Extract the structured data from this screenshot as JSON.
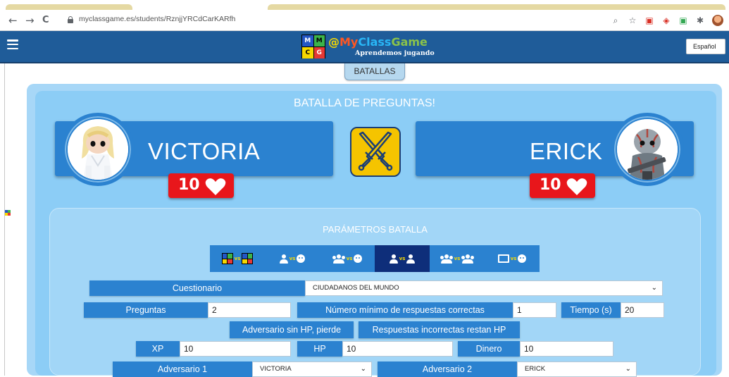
{
  "browser": {
    "url": "myclassgame.es/students/RznjjYRCdCarKARfh",
    "back_icon": "←",
    "forward_icon": "→",
    "reload_icon": "C",
    "zoom_icon": "⌕",
    "star_icon": "☆"
  },
  "header": {
    "logo_letters": [
      "M",
      "M",
      "C",
      "G"
    ],
    "brand_at": "@",
    "brand_my": "My",
    "brand_class": "Class",
    "brand_game": "Game",
    "tagline": "Aprendemos jugando",
    "language": "Español"
  },
  "tabs": {
    "battles": "BATALLAS"
  },
  "battle": {
    "title": "BATALLA DE PREGUNTAS!",
    "player1": {
      "name": "VICTORIA",
      "hp": "10"
    },
    "player2": {
      "name": "ERICK",
      "hp": "10"
    }
  },
  "params": {
    "title": "PARÁMETROS BATALLA",
    "modes": [
      {
        "name": "class-vs-class",
        "vs": "vs"
      },
      {
        "name": "student-vs-face",
        "vs": "vs"
      },
      {
        "name": "team-vs-face",
        "vs": "vs"
      },
      {
        "name": "student-vs-student",
        "vs": "vs",
        "active": true
      },
      {
        "name": "team-vs-team",
        "vs": "vs"
      },
      {
        "name": "board-vs-face",
        "vs": "vs"
      }
    ],
    "questionnaire_label": "Cuestionario",
    "questionnaire_value": "CIUDADANOS DEL MUNDO",
    "questions_label": "Preguntas",
    "questions_value": "2",
    "min_correct_label": "Número mínimo de respuestas correctas",
    "min_correct_value": "1",
    "time_label": "Tiempo (s)",
    "time_value": "20",
    "no_hp_label": "Adversario sin HP, pierde",
    "wrong_answers_label": "Respuestas incorrectas restan HP",
    "xp_label": "XP",
    "xp_value": "10",
    "hp_label": "HP",
    "hp_value": "10",
    "money_label": "Dinero",
    "money_value": "10",
    "adv1_label": "Adversario 1",
    "adv1_value": "VICTORIA",
    "adv2_label": "Adversario 2",
    "adv2_value": "ERICK"
  },
  "colors": {
    "header_blue": "#1f5c99",
    "panel_blue": "#2b82d0",
    "light_blue": "#a7d7f7",
    "hp_red": "#e8161b",
    "swords_yellow": "#f5c400",
    "active_mode": "#0e2e7a"
  }
}
